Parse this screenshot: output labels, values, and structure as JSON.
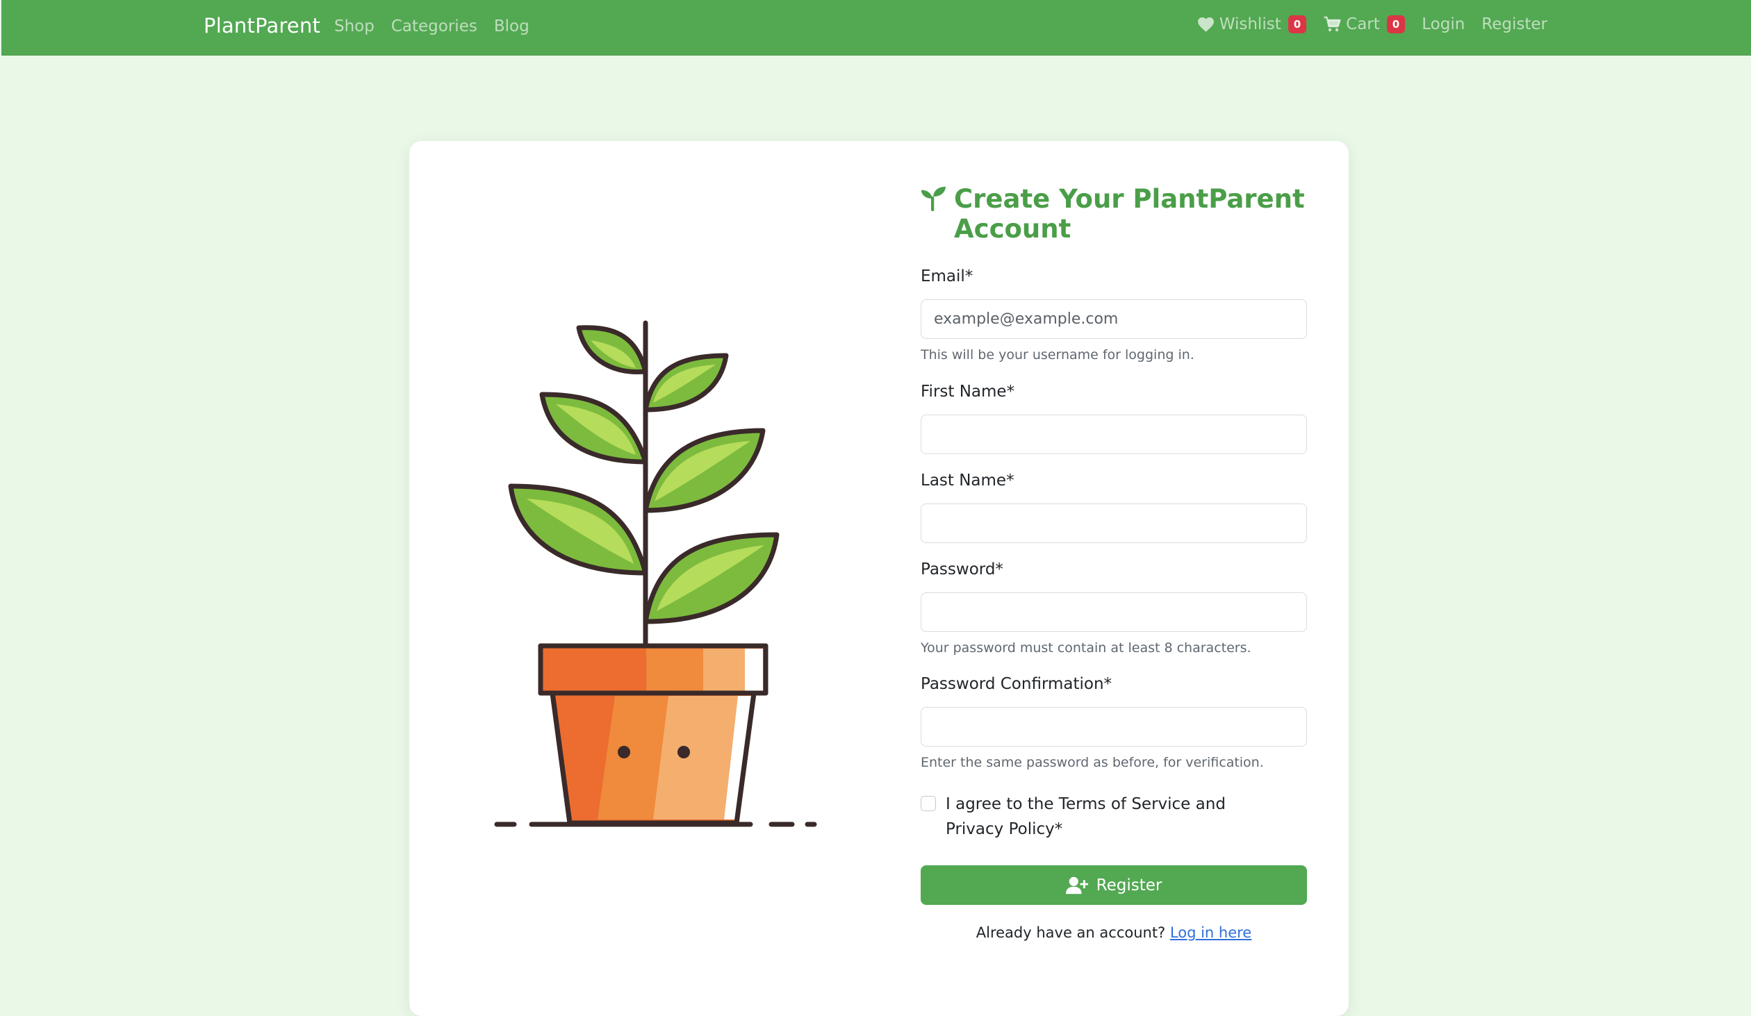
{
  "colors": {
    "navbar": "#53a852",
    "page_background": "#eaf8e8",
    "accent_green": "#4a9e48",
    "badge_red": "#dc3545",
    "link_blue": "#2f6fdc"
  },
  "nav": {
    "brand": "PlantParent",
    "left_links": [
      "Shop",
      "Categories",
      "Blog"
    ],
    "wishlist_label": "Wishlist",
    "wishlist_icon": "heart-icon",
    "wishlist_count": "0",
    "cart_label": "Cart",
    "cart_icon": "cart-icon",
    "cart_count": "0",
    "login_label": "Login",
    "register_label": "Register"
  },
  "form": {
    "title_icon": "sprout-icon",
    "title": "Create Your PlantParent Account",
    "email": {
      "label": "Email*",
      "placeholder": "example@example.com",
      "help": "This will be your username for logging in."
    },
    "first_name": {
      "label": "First Name*",
      "value": ""
    },
    "last_name": {
      "label": "Last Name*",
      "value": ""
    },
    "password": {
      "label": "Password*",
      "help": "Your password must contain at least 8 characters."
    },
    "password_confirmation": {
      "label": "Password Confirmation*",
      "help": "Enter the same password as before, for verification."
    },
    "terms_label": "I agree to the Terms of Service and Privacy Policy*",
    "terms_checked": false,
    "submit_icon": "user-plus-icon",
    "submit_label": "Register",
    "login_prompt": "Already have an account?",
    "login_link": "Log in here"
  },
  "illustration": {
    "icon": "potted-plant-illustration"
  }
}
